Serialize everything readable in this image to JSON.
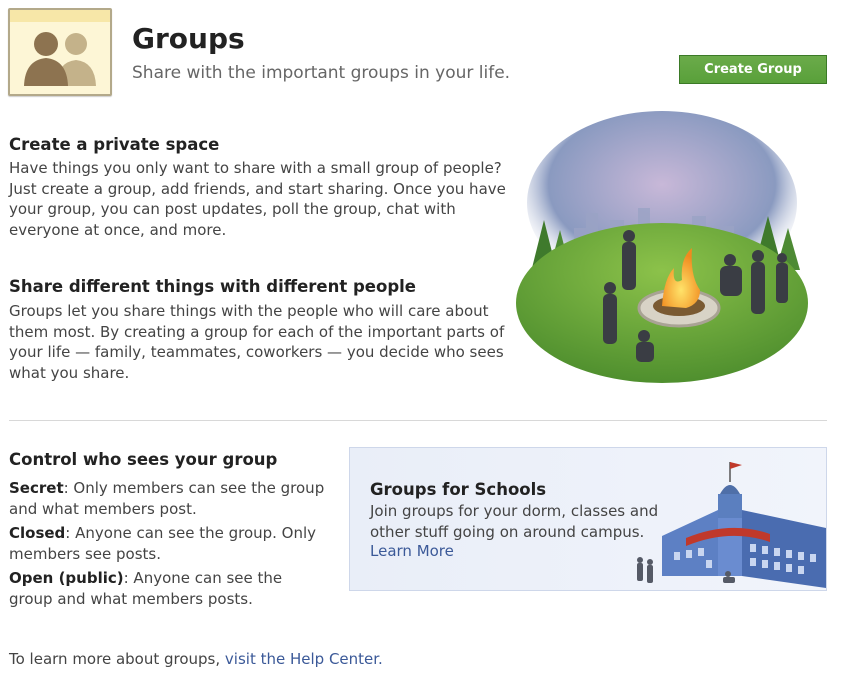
{
  "header": {
    "icon": "groups-people-icon",
    "title": "Groups",
    "subtitle": "Share with the important groups in your life.",
    "create_button": "Create Group"
  },
  "sections": {
    "private": {
      "heading": "Create a private space",
      "body": "Have things you only want to share with a small group of people? Just create a group, add friends, and start sharing. Once you have your group, you can post updates, poll the group, chat with everyone at once, and more."
    },
    "share": {
      "heading": "Share different things with different people",
      "body": "Groups let you share things with the people who will care about them most. By creating a group for each of the important parts of your life — family, teammates, coworkers — you decide who sees what you share."
    },
    "control": {
      "heading": "Control who sees your group",
      "items": [
        {
          "label": "Secret",
          "text": ": Only members can see the group and what members post."
        },
        {
          "label": "Closed",
          "text": ": Anyone can see the group. Only members see posts."
        },
        {
          "label": "Open (public)",
          "text": ": Anyone can see the group and what members posts."
        }
      ]
    }
  },
  "schools": {
    "title": "Groups for Schools",
    "description": "Join groups for your dorm, classes and other stuff going on around campus.",
    "link": "Learn More"
  },
  "footer": {
    "text": "To learn more about groups, ",
    "link": "visit the Help Center."
  },
  "colors": {
    "accent_green": "#5ba33b",
    "link_blue": "#3b5998"
  }
}
